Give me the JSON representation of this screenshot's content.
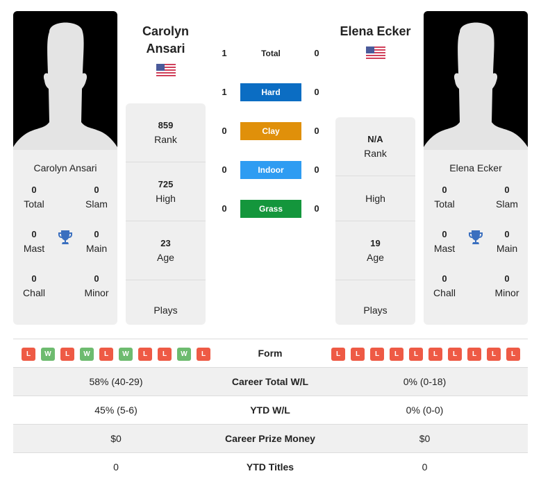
{
  "colors": {
    "hard": "#0b6dc3",
    "clay": "#e0900a",
    "indoor": "#2e9cf2",
    "grass": "#14963c",
    "loss": "#ee5a45",
    "win": "#6dbb6f",
    "trophy": "#3a6fbf"
  },
  "player1": {
    "header_name_line1": "Carolyn",
    "header_name_line2": "Ansari",
    "flag": "us-flag",
    "card_name": "Carolyn Ansari",
    "titles": {
      "total": {
        "value": "0",
        "label": "Total"
      },
      "slam": {
        "value": "0",
        "label": "Slam"
      },
      "mast": {
        "value": "0",
        "label": "Mast"
      },
      "main": {
        "value": "0",
        "label": "Main"
      },
      "chall": {
        "value": "0",
        "label": "Chall"
      },
      "minor": {
        "value": "0",
        "label": "Minor"
      }
    },
    "stats": {
      "rank": {
        "value": "859",
        "label": "Rank"
      },
      "high": {
        "value": "725",
        "label": "High"
      },
      "age": {
        "value": "23",
        "label": "Age"
      },
      "plays": {
        "value": "",
        "label": "Plays"
      }
    },
    "form": [
      "L",
      "W",
      "L",
      "W",
      "L",
      "W",
      "L",
      "L",
      "W",
      "L"
    ]
  },
  "player2": {
    "header_name": "Elena Ecker",
    "flag": "us-flag",
    "card_name": "Elena Ecker",
    "titles": {
      "total": {
        "value": "0",
        "label": "Total"
      },
      "slam": {
        "value": "0",
        "label": "Slam"
      },
      "mast": {
        "value": "0",
        "label": "Mast"
      },
      "main": {
        "value": "0",
        "label": "Main"
      },
      "chall": {
        "value": "0",
        "label": "Chall"
      },
      "minor": {
        "value": "0",
        "label": "Minor"
      }
    },
    "stats": {
      "rank": {
        "value": "N/A",
        "label": "Rank"
      },
      "high": {
        "value": "",
        "label": "High"
      },
      "age": {
        "value": "19",
        "label": "Age"
      },
      "plays": {
        "value": "",
        "label": "Plays"
      }
    },
    "form": [
      "L",
      "L",
      "L",
      "L",
      "L",
      "L",
      "L",
      "L",
      "L",
      "L"
    ]
  },
  "h2h": [
    {
      "label": "Total",
      "p1": "1",
      "p2": "0",
      "surface": "total"
    },
    {
      "label": "Hard",
      "p1": "1",
      "p2": "0",
      "surface": "hard"
    },
    {
      "label": "Clay",
      "p1": "0",
      "p2": "0",
      "surface": "clay"
    },
    {
      "label": "Indoor",
      "p1": "0",
      "p2": "0",
      "surface": "indoor"
    },
    {
      "label": "Grass",
      "p1": "0",
      "p2": "0",
      "surface": "grass"
    }
  ],
  "table": {
    "form_label": "Form",
    "rows": [
      {
        "p1": "58% (40-29)",
        "label": "Career Total W/L",
        "p2": "0% (0-18)"
      },
      {
        "p1": "45% (5-6)",
        "label": "YTD W/L",
        "p2": "0% (0-0)"
      },
      {
        "p1": "$0",
        "label": "Career Prize Money",
        "p2": "$0"
      },
      {
        "p1": "0",
        "label": "YTD Titles",
        "p2": "0"
      }
    ]
  }
}
